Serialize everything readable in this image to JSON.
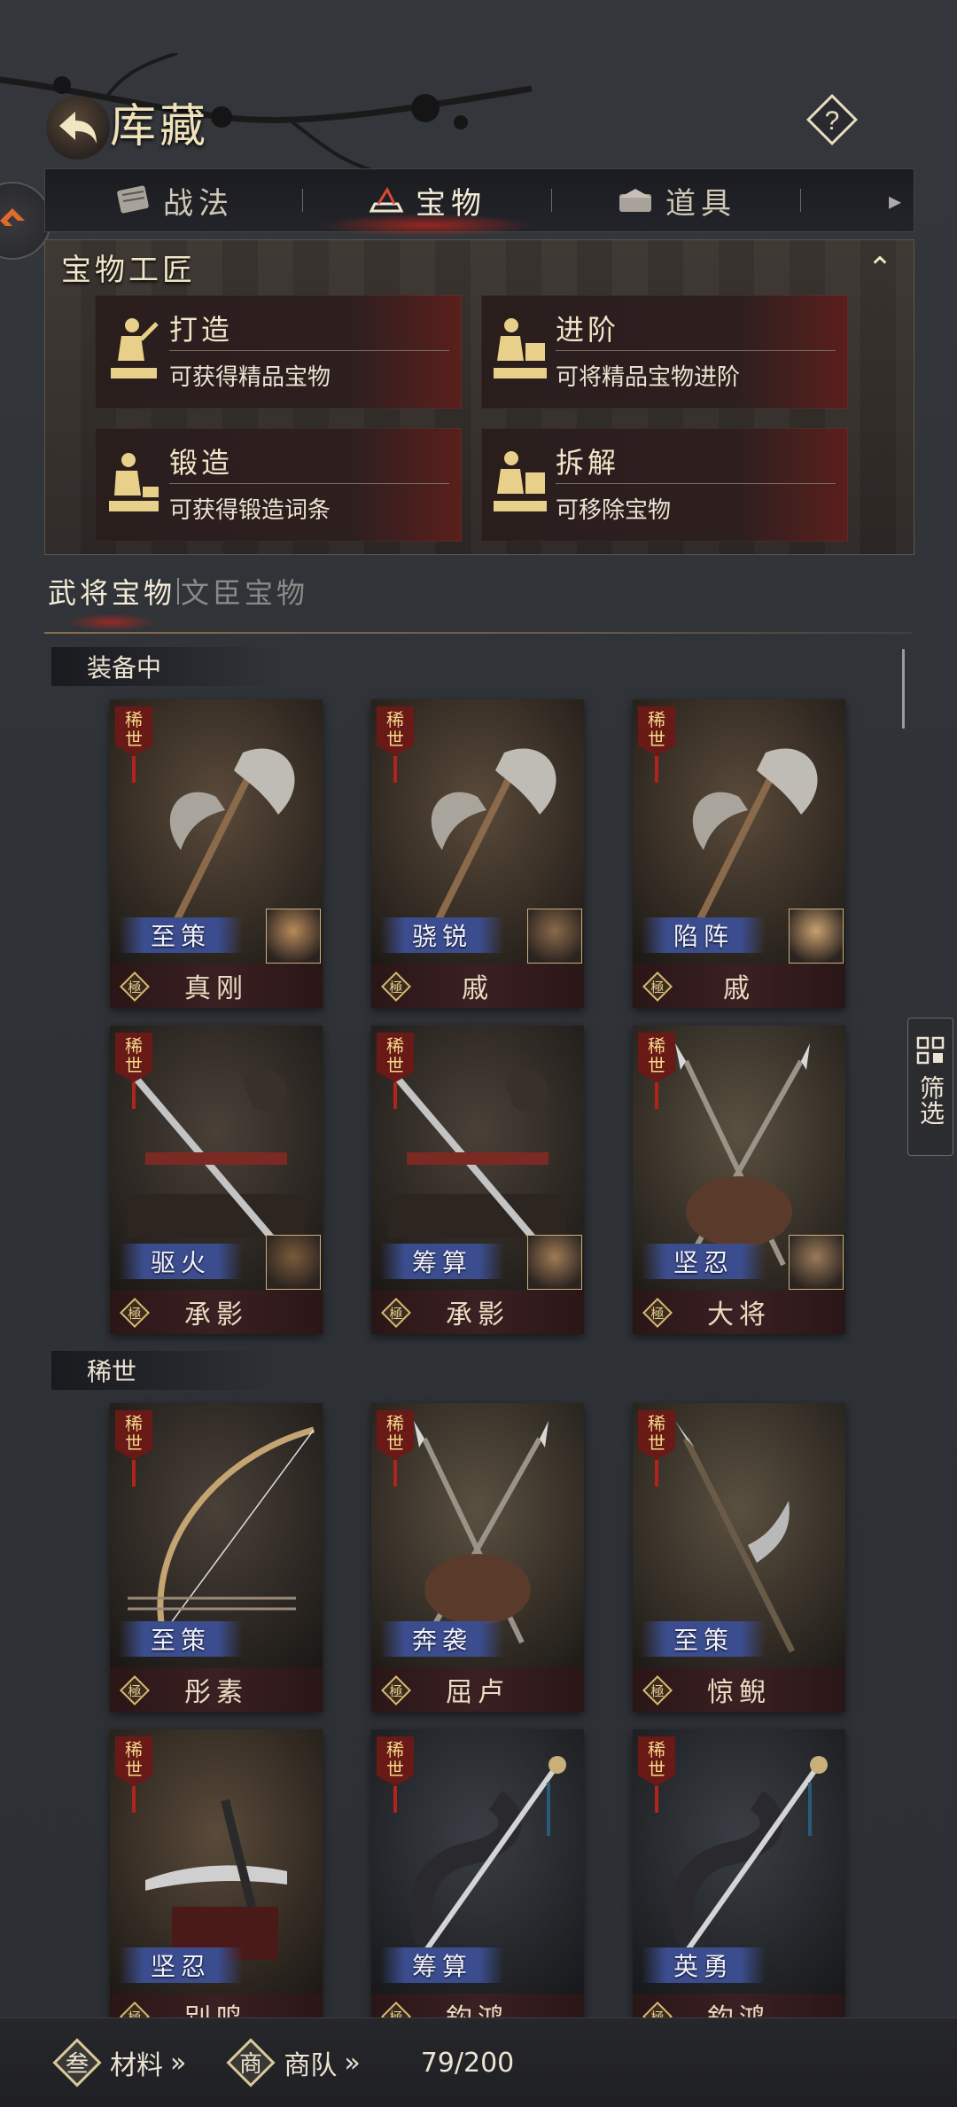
{
  "header": {
    "title": "库藏"
  },
  "tabs": [
    {
      "label": "战法",
      "icon": "scroll-icon"
    },
    {
      "label": "宝物",
      "icon": "treasure-icon",
      "active": true
    },
    {
      "label": "道具",
      "icon": "chest-icon"
    }
  ],
  "craft": {
    "title": "宝物工匠",
    "items": [
      {
        "name": "打造",
        "desc": "可获得精品宝物"
      },
      {
        "name": "进阶",
        "desc": "可将精品宝物进阶"
      },
      {
        "name": "锻造",
        "desc": "可获得锻造词条"
      },
      {
        "name": "拆解",
        "desc": "可移除宝物"
      }
    ]
  },
  "sub_tabs": [
    {
      "label": "武将宝物",
      "active": true
    },
    {
      "label": "文臣宝物"
    }
  ],
  "sections": {
    "equipped": "装备中",
    "rare": "稀世"
  },
  "rarity_label": "稀世",
  "grade_label": "極",
  "items": [
    {
      "skill": "至策",
      "name": "真刚",
      "weapon": "axe",
      "section": "equipped"
    },
    {
      "skill": "骁锐",
      "name": "戚",
      "weapon": "axe",
      "section": "equipped"
    },
    {
      "skill": "陷阵",
      "name": "戚",
      "weapon": "axe",
      "section": "equipped"
    },
    {
      "skill": "驱火",
      "name": "承影",
      "weapon": "sword",
      "section": "equipped"
    },
    {
      "skill": "筹算",
      "name": "承影",
      "weapon": "sword",
      "section": "equipped"
    },
    {
      "skill": "坚忍",
      "name": "大将",
      "weapon": "spear",
      "section": "equipped"
    },
    {
      "skill": "至策",
      "name": "彤素",
      "weapon": "bow",
      "section": "rare"
    },
    {
      "skill": "奔袭",
      "name": "屈卢",
      "weapon": "spear",
      "section": "rare"
    },
    {
      "skill": "至策",
      "name": "惊鲵",
      "weapon": "halberd",
      "section": "rare"
    },
    {
      "skill": "坚忍",
      "name": "别鸣",
      "weapon": "blade",
      "section": "rare"
    },
    {
      "skill": "筹算",
      "name": "鈎鸿",
      "weapon": "dragon-sword",
      "section": "rare"
    },
    {
      "skill": "英勇",
      "name": "鈎鸿",
      "weapon": "dragon-sword",
      "section": "rare"
    }
  ],
  "filter": {
    "label": "筛选"
  },
  "bottom": {
    "materials_label": "材料",
    "materials_arrow": "»",
    "materials_icon": "叁",
    "merchant_label": "商队",
    "merchant_arrow": "»",
    "merchant_icon": "商",
    "count": "79/200"
  },
  "colors": {
    "accent_red": "#be281e",
    "gold": "#efe2b9",
    "skill_blue": "#3b4d8f"
  }
}
